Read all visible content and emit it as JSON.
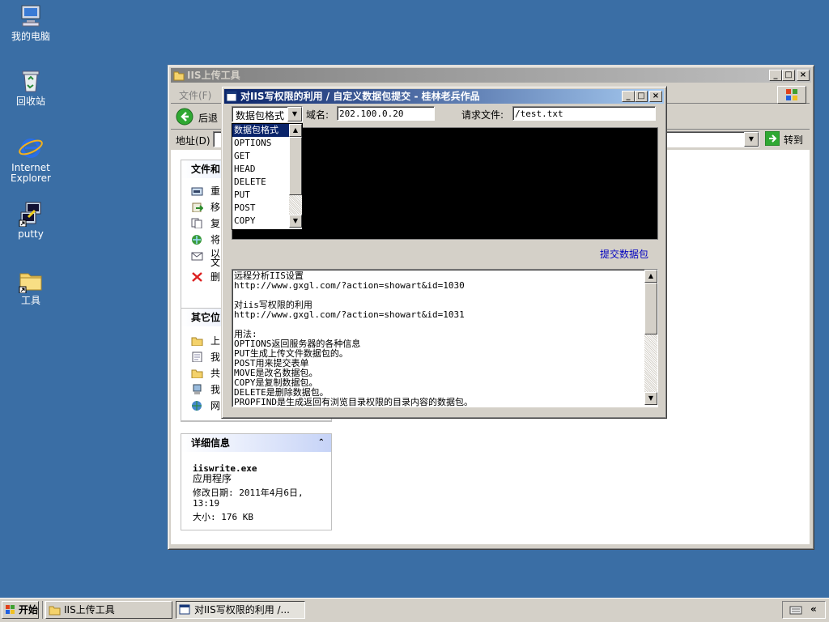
{
  "desktop": {
    "icons": [
      {
        "label": "我的电脑",
        "icon": "my-computer-icon"
      },
      {
        "label": "回收站",
        "icon": "recycle-bin-icon"
      },
      {
        "label": "Internet\nExplorer",
        "icon": "internet-explorer-icon"
      },
      {
        "label": "putty",
        "icon": "putty-icon"
      },
      {
        "label": "工具",
        "icon": "folder-icon"
      }
    ]
  },
  "explorer": {
    "title": "IIS上传工具",
    "menu_file": "文件(F)",
    "back_label": "后退",
    "address_label": "地址(D)",
    "go_label": "转到",
    "tasks_header": "文件和",
    "task_items": [
      "重",
      "移",
      "复",
      "将",
      "以\n文",
      "删"
    ],
    "other_header": "其它位",
    "other_items": [
      "上",
      "我",
      "共",
      "我",
      "网"
    ],
    "details_header": "详细信息",
    "details_name": "iiswrite.exe",
    "details_type": "应用程序",
    "details_modified": "修改日期: 2011年4月6日,\n13:19",
    "details_size": "大小: 176 KB"
  },
  "tool": {
    "title": "对IIS写权限的利用 / 自定义数据包提交 - 桂林老兵作品",
    "format_selected": "数据包格式",
    "domain_label": "域名:",
    "domain_value": "202.100.0.20",
    "request_label": "请求文件:",
    "request_value": "/test.txt",
    "dropdown_options": [
      "数据包格式",
      "OPTIONS",
      "GET",
      "HEAD",
      "DELETE",
      "PUT",
      "POST",
      "COPY"
    ],
    "submit_link": "提交数据包",
    "info_lines": [
      "远程分析IIS设置",
      "http://www.gxgl.com/?action=showart&id=1030",
      "",
      "对iis写权限的利用",
      "http://www.gxgl.com/?action=showart&id=1031",
      "",
      "用法:",
      "OPTIONS返回服务器的各种信息",
      "PUT生成上传文件数据包的。",
      "POST用来提交表单",
      "MOVE是改名数据包。",
      "COPY是复制数据包。",
      "DELETE是删除数据包。",
      "PROPFIND是生成返回有浏览目录权限的目录内容的数据包。"
    ]
  },
  "taskbar": {
    "start_label": "开始",
    "task1": "IIS上传工具",
    "task2": "对IIS写权限的利用 /..."
  }
}
